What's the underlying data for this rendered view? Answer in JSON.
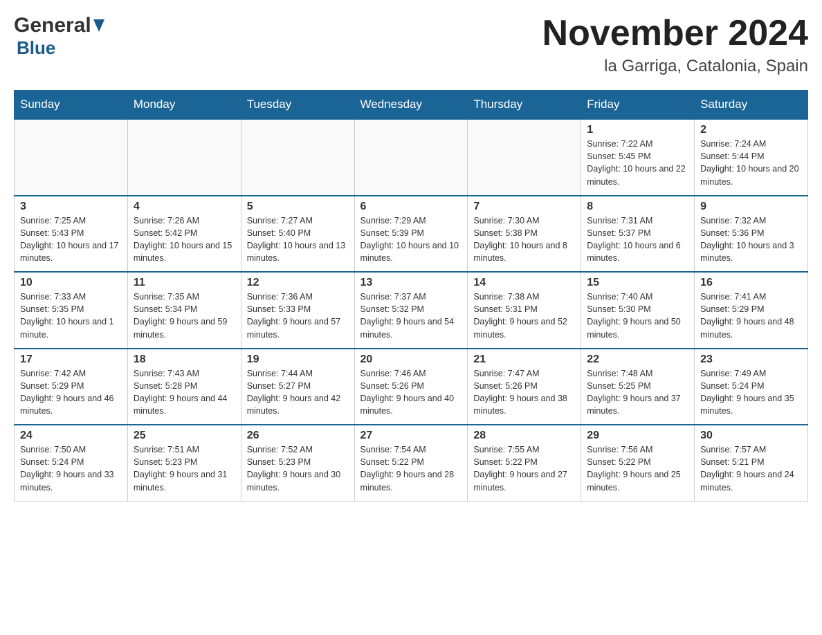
{
  "header": {
    "logo_general": "General",
    "logo_blue": "Blue",
    "month_title": "November 2024",
    "location": "la Garriga, Catalonia, Spain"
  },
  "weekdays": [
    "Sunday",
    "Monday",
    "Tuesday",
    "Wednesday",
    "Thursday",
    "Friday",
    "Saturday"
  ],
  "weeks": [
    [
      {
        "day": "",
        "info": ""
      },
      {
        "day": "",
        "info": ""
      },
      {
        "day": "",
        "info": ""
      },
      {
        "day": "",
        "info": ""
      },
      {
        "day": "",
        "info": ""
      },
      {
        "day": "1",
        "info": "Sunrise: 7:22 AM\nSunset: 5:45 PM\nDaylight: 10 hours and 22 minutes."
      },
      {
        "day": "2",
        "info": "Sunrise: 7:24 AM\nSunset: 5:44 PM\nDaylight: 10 hours and 20 minutes."
      }
    ],
    [
      {
        "day": "3",
        "info": "Sunrise: 7:25 AM\nSunset: 5:43 PM\nDaylight: 10 hours and 17 minutes."
      },
      {
        "day": "4",
        "info": "Sunrise: 7:26 AM\nSunset: 5:42 PM\nDaylight: 10 hours and 15 minutes."
      },
      {
        "day": "5",
        "info": "Sunrise: 7:27 AM\nSunset: 5:40 PM\nDaylight: 10 hours and 13 minutes."
      },
      {
        "day": "6",
        "info": "Sunrise: 7:29 AM\nSunset: 5:39 PM\nDaylight: 10 hours and 10 minutes."
      },
      {
        "day": "7",
        "info": "Sunrise: 7:30 AM\nSunset: 5:38 PM\nDaylight: 10 hours and 8 minutes."
      },
      {
        "day": "8",
        "info": "Sunrise: 7:31 AM\nSunset: 5:37 PM\nDaylight: 10 hours and 6 minutes."
      },
      {
        "day": "9",
        "info": "Sunrise: 7:32 AM\nSunset: 5:36 PM\nDaylight: 10 hours and 3 minutes."
      }
    ],
    [
      {
        "day": "10",
        "info": "Sunrise: 7:33 AM\nSunset: 5:35 PM\nDaylight: 10 hours and 1 minute."
      },
      {
        "day": "11",
        "info": "Sunrise: 7:35 AM\nSunset: 5:34 PM\nDaylight: 9 hours and 59 minutes."
      },
      {
        "day": "12",
        "info": "Sunrise: 7:36 AM\nSunset: 5:33 PM\nDaylight: 9 hours and 57 minutes."
      },
      {
        "day": "13",
        "info": "Sunrise: 7:37 AM\nSunset: 5:32 PM\nDaylight: 9 hours and 54 minutes."
      },
      {
        "day": "14",
        "info": "Sunrise: 7:38 AM\nSunset: 5:31 PM\nDaylight: 9 hours and 52 minutes."
      },
      {
        "day": "15",
        "info": "Sunrise: 7:40 AM\nSunset: 5:30 PM\nDaylight: 9 hours and 50 minutes."
      },
      {
        "day": "16",
        "info": "Sunrise: 7:41 AM\nSunset: 5:29 PM\nDaylight: 9 hours and 48 minutes."
      }
    ],
    [
      {
        "day": "17",
        "info": "Sunrise: 7:42 AM\nSunset: 5:29 PM\nDaylight: 9 hours and 46 minutes."
      },
      {
        "day": "18",
        "info": "Sunrise: 7:43 AM\nSunset: 5:28 PM\nDaylight: 9 hours and 44 minutes."
      },
      {
        "day": "19",
        "info": "Sunrise: 7:44 AM\nSunset: 5:27 PM\nDaylight: 9 hours and 42 minutes."
      },
      {
        "day": "20",
        "info": "Sunrise: 7:46 AM\nSunset: 5:26 PM\nDaylight: 9 hours and 40 minutes."
      },
      {
        "day": "21",
        "info": "Sunrise: 7:47 AM\nSunset: 5:26 PM\nDaylight: 9 hours and 38 minutes."
      },
      {
        "day": "22",
        "info": "Sunrise: 7:48 AM\nSunset: 5:25 PM\nDaylight: 9 hours and 37 minutes."
      },
      {
        "day": "23",
        "info": "Sunrise: 7:49 AM\nSunset: 5:24 PM\nDaylight: 9 hours and 35 minutes."
      }
    ],
    [
      {
        "day": "24",
        "info": "Sunrise: 7:50 AM\nSunset: 5:24 PM\nDaylight: 9 hours and 33 minutes."
      },
      {
        "day": "25",
        "info": "Sunrise: 7:51 AM\nSunset: 5:23 PM\nDaylight: 9 hours and 31 minutes."
      },
      {
        "day": "26",
        "info": "Sunrise: 7:52 AM\nSunset: 5:23 PM\nDaylight: 9 hours and 30 minutes."
      },
      {
        "day": "27",
        "info": "Sunrise: 7:54 AM\nSunset: 5:22 PM\nDaylight: 9 hours and 28 minutes."
      },
      {
        "day": "28",
        "info": "Sunrise: 7:55 AM\nSunset: 5:22 PM\nDaylight: 9 hours and 27 minutes."
      },
      {
        "day": "29",
        "info": "Sunrise: 7:56 AM\nSunset: 5:22 PM\nDaylight: 9 hours and 25 minutes."
      },
      {
        "day": "30",
        "info": "Sunrise: 7:57 AM\nSunset: 5:21 PM\nDaylight: 9 hours and 24 minutes."
      }
    ]
  ]
}
